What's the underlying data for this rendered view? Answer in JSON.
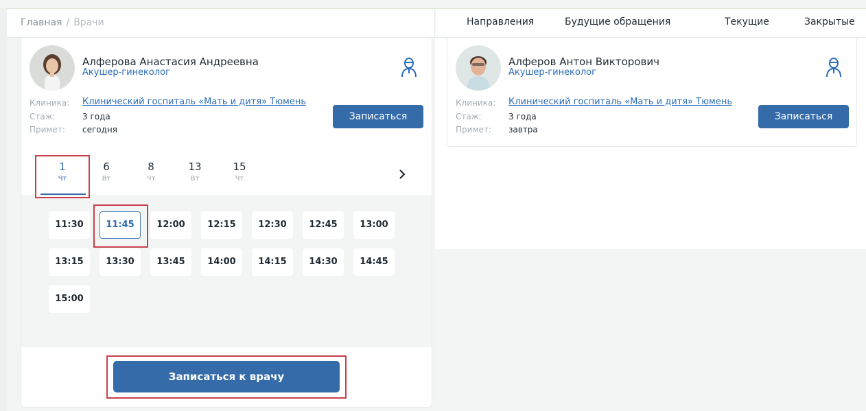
{
  "breadcrumb": {
    "home": "Главная",
    "separator": "/",
    "current": "Врачи"
  },
  "tabs": [
    {
      "label": "Направления"
    },
    {
      "label": "Будущие обращения"
    },
    {
      "label": "Текущие"
    },
    {
      "label": "Закрытые"
    }
  ],
  "labels": {
    "clinic": "Клиника:",
    "experience": "Стаж:",
    "accepts": "Примет:"
  },
  "doctors": [
    {
      "name": "Алферова Анастасия Андреевна",
      "specialty": "Акушер-гинеколог",
      "clinic": "Клинический госпиталь «Мать и дитя» Тюмень",
      "experience": "3 года",
      "accepts": "сегодня",
      "book_label": "Записаться",
      "icon": "doctor-icon"
    },
    {
      "name": "Алферов Антон Викторович",
      "specialty": "Акушер-гинеколог",
      "clinic": "Клинический госпиталь «Мать и дитя» Тюмень",
      "experience": "3 года",
      "accepts": "завтра",
      "book_label": "Записаться",
      "icon": "doctor-icon"
    }
  ],
  "dates": [
    {
      "day": "1",
      "weekday": "Чт",
      "active": true
    },
    {
      "day": "6",
      "weekday": "Вт"
    },
    {
      "day": "8",
      "weekday": "Чт"
    },
    {
      "day": "13",
      "weekday": "Вт"
    },
    {
      "day": "15",
      "weekday": "Чт"
    }
  ],
  "slots": [
    "11:30",
    "11:45",
    "12:00",
    "12:15",
    "12:30",
    "12:45",
    "13:00",
    "13:15",
    "13:30",
    "13:45",
    "14:00",
    "14:15",
    "14:30",
    "14:45",
    "15:00"
  ],
  "selected_slot": "11:45",
  "book_doctor_label": "Записаться к врачу",
  "colors": {
    "primary": "#356ba8",
    "link": "#2b6cb6",
    "highlight": "#c8404a",
    "background": "#f3f5f5"
  }
}
